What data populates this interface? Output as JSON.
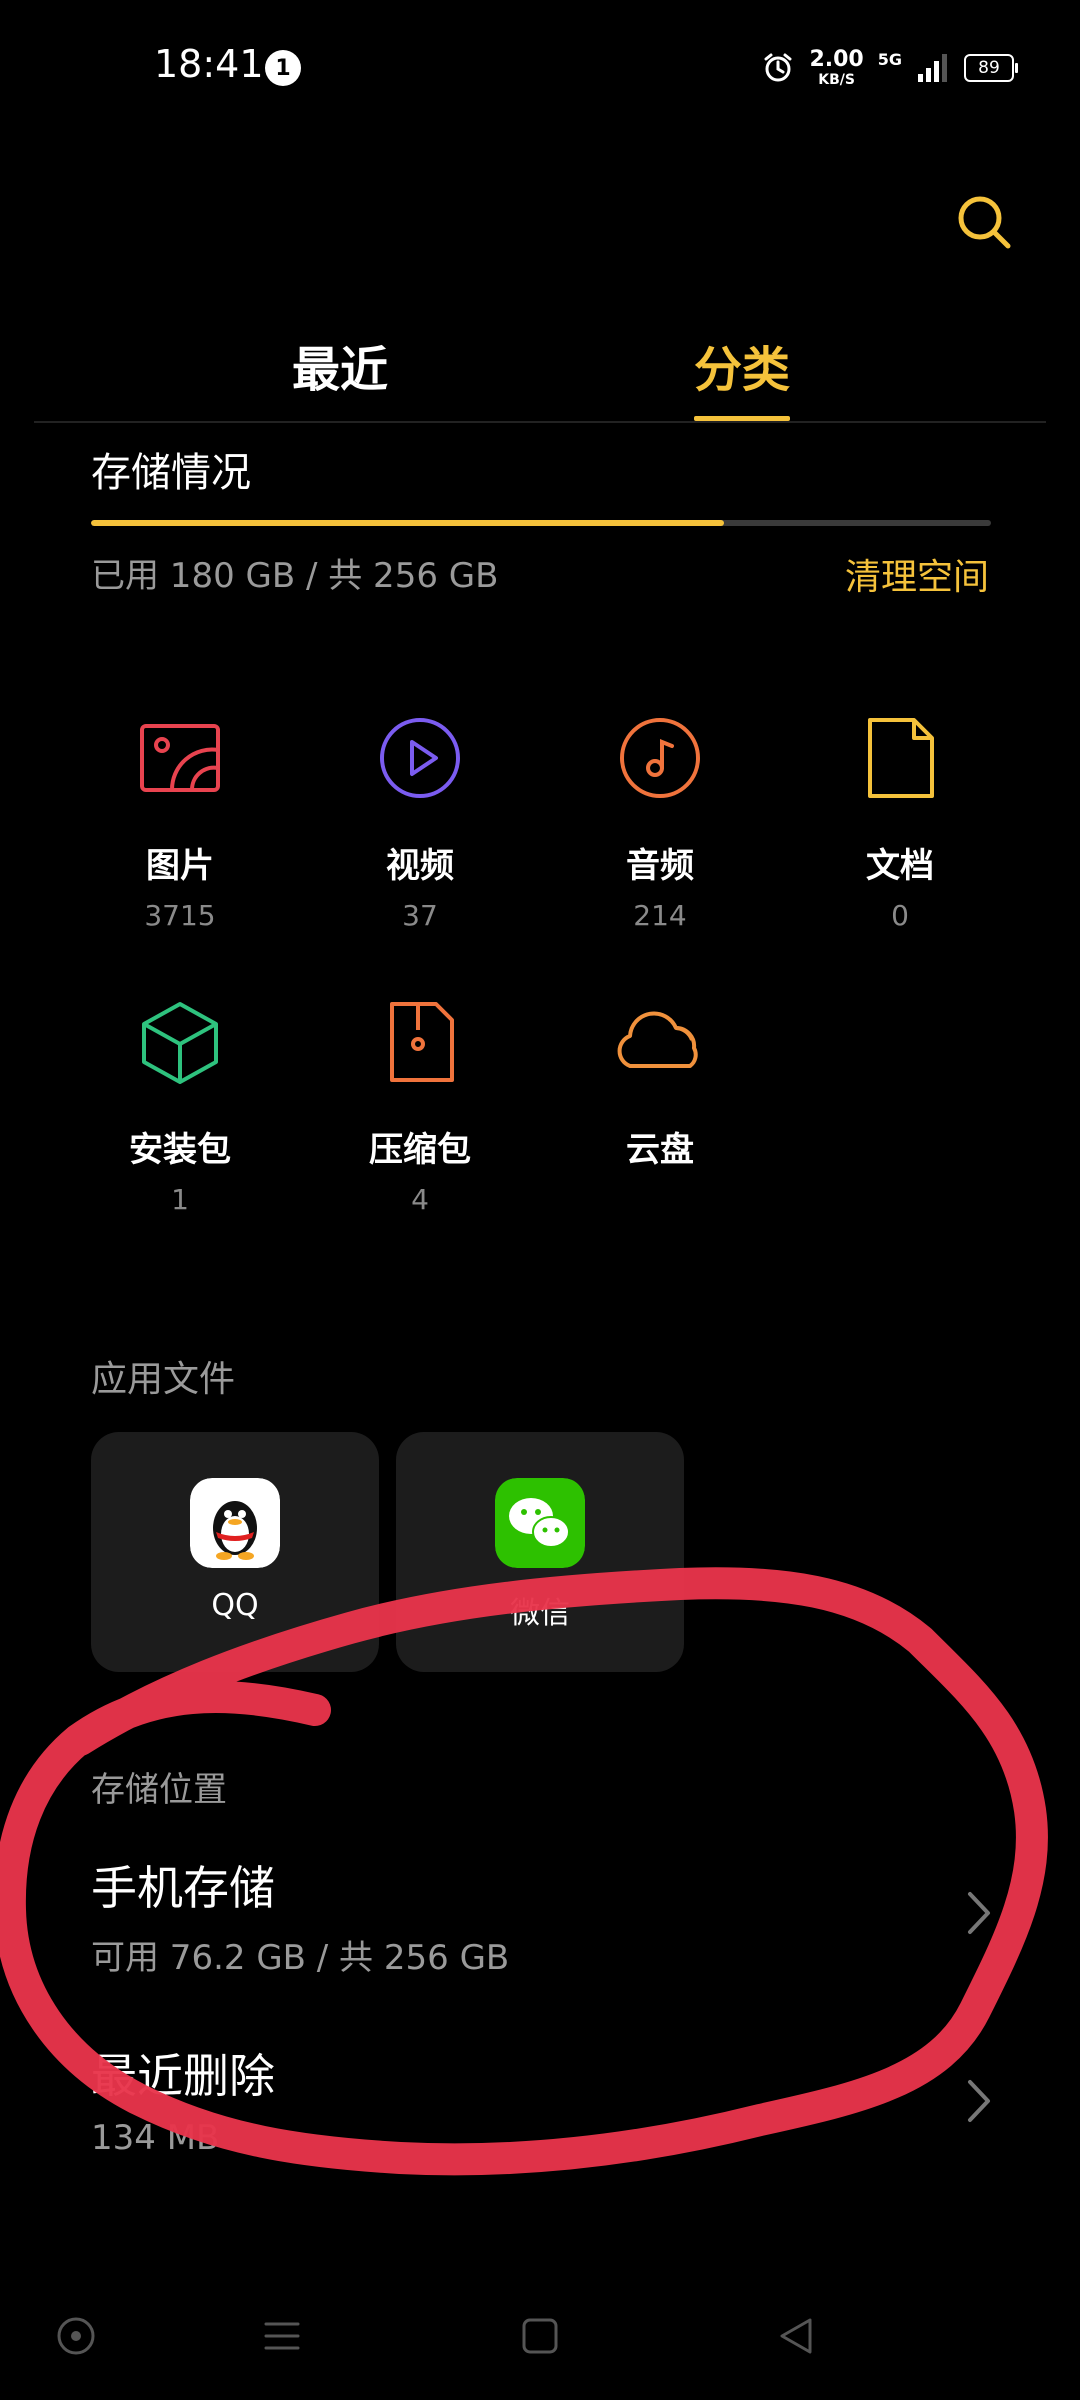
{
  "status_bar": {
    "time": "18:41",
    "notification_count": "1",
    "speed_value": "2.00",
    "speed_unit": "KB/S",
    "network": "5G",
    "battery": "89"
  },
  "tabs": [
    {
      "label": "最近",
      "active": false
    },
    {
      "label": "分类",
      "active": true
    }
  ],
  "storage": {
    "title": "存储情况",
    "usage_text": "已用 180 GB / 共 256 GB",
    "used_fraction": 0.703,
    "clean_label": "清理空间"
  },
  "categories": [
    {
      "label": "图片",
      "count": "3715",
      "icon": "image-icon",
      "color": "#E8434F"
    },
    {
      "label": "视频",
      "count": "37",
      "icon": "video-icon",
      "color": "#7B5CF0"
    },
    {
      "label": "音频",
      "count": "214",
      "icon": "audio-icon",
      "color": "#F0733C"
    },
    {
      "label": "文档",
      "count": "0",
      "icon": "document-icon",
      "color": "#F5C23B"
    },
    {
      "label": "安装包",
      "count": "1",
      "icon": "package-icon",
      "color": "#2EC27E"
    },
    {
      "label": "压缩包",
      "count": "4",
      "icon": "archive-icon",
      "color": "#F0733C"
    },
    {
      "label": "云盘",
      "count": "",
      "icon": "cloud-icon",
      "color": "#F0913C"
    }
  ],
  "app_files": {
    "title": "应用文件",
    "apps": [
      {
        "label": "QQ",
        "icon": "qq-icon"
      },
      {
        "label": "微信",
        "icon": "wechat-icon"
      }
    ]
  },
  "locations": {
    "title": "存储位置",
    "items": [
      {
        "name": "手机存储",
        "detail": "可用 76.2 GB / 共 256 GB"
      },
      {
        "name": "最近删除",
        "detail": "134 MB"
      }
    ]
  },
  "colors": {
    "accent": "#F5C23B",
    "annotation": "#E8344B"
  }
}
